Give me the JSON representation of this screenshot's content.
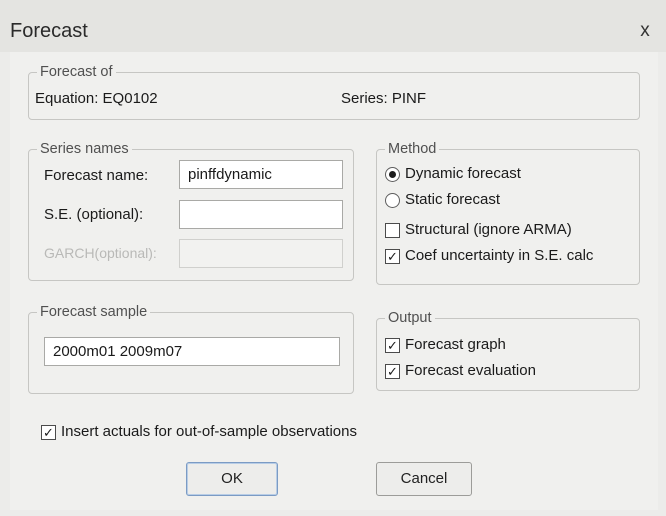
{
  "window": {
    "title": "Forecast",
    "close_glyph": "x"
  },
  "forecast_of": {
    "legend": "Forecast of",
    "equation": "Equation: EQ0102",
    "series": "Series: PINF"
  },
  "series_names": {
    "legend": "Series names",
    "forecast_name_label": "Forecast name:",
    "forecast_name_value": "pinffdynamic",
    "se_label": "S.E. (optional):",
    "se_value": "",
    "garch_label": "GARCH(optional):",
    "garch_value": ""
  },
  "method": {
    "legend": "Method",
    "dynamic_label": "Dynamic forecast",
    "dynamic_selected": true,
    "static_label": "Static forecast",
    "static_selected": false,
    "structural_label": "Structural (ignore ARMA)",
    "structural_checked": false,
    "coef_label": "Coef uncertainty in S.E. calc",
    "coef_checked": true
  },
  "forecast_sample": {
    "legend": "Forecast sample",
    "value": "2000m01 2009m07"
  },
  "output": {
    "legend": "Output",
    "graph_label": "Forecast graph",
    "graph_checked": true,
    "evaluation_label": "Forecast evaluation",
    "evaluation_checked": true
  },
  "insert_actuals": {
    "label": "Insert actuals for out-of-sample observations",
    "checked": true
  },
  "buttons": {
    "ok": "OK",
    "cancel": "Cancel"
  },
  "icons": {
    "window_close": "close-icon",
    "radio_selected": "radio-selected-icon",
    "radio_unselected": "radio-unselected-icon",
    "checkbox_checked": "checkmark-icon"
  },
  "colors": {
    "window_bg": "#f0f0ee",
    "title_bg": "#e4e4e1",
    "default_button_border": "#7b9bc4"
  }
}
